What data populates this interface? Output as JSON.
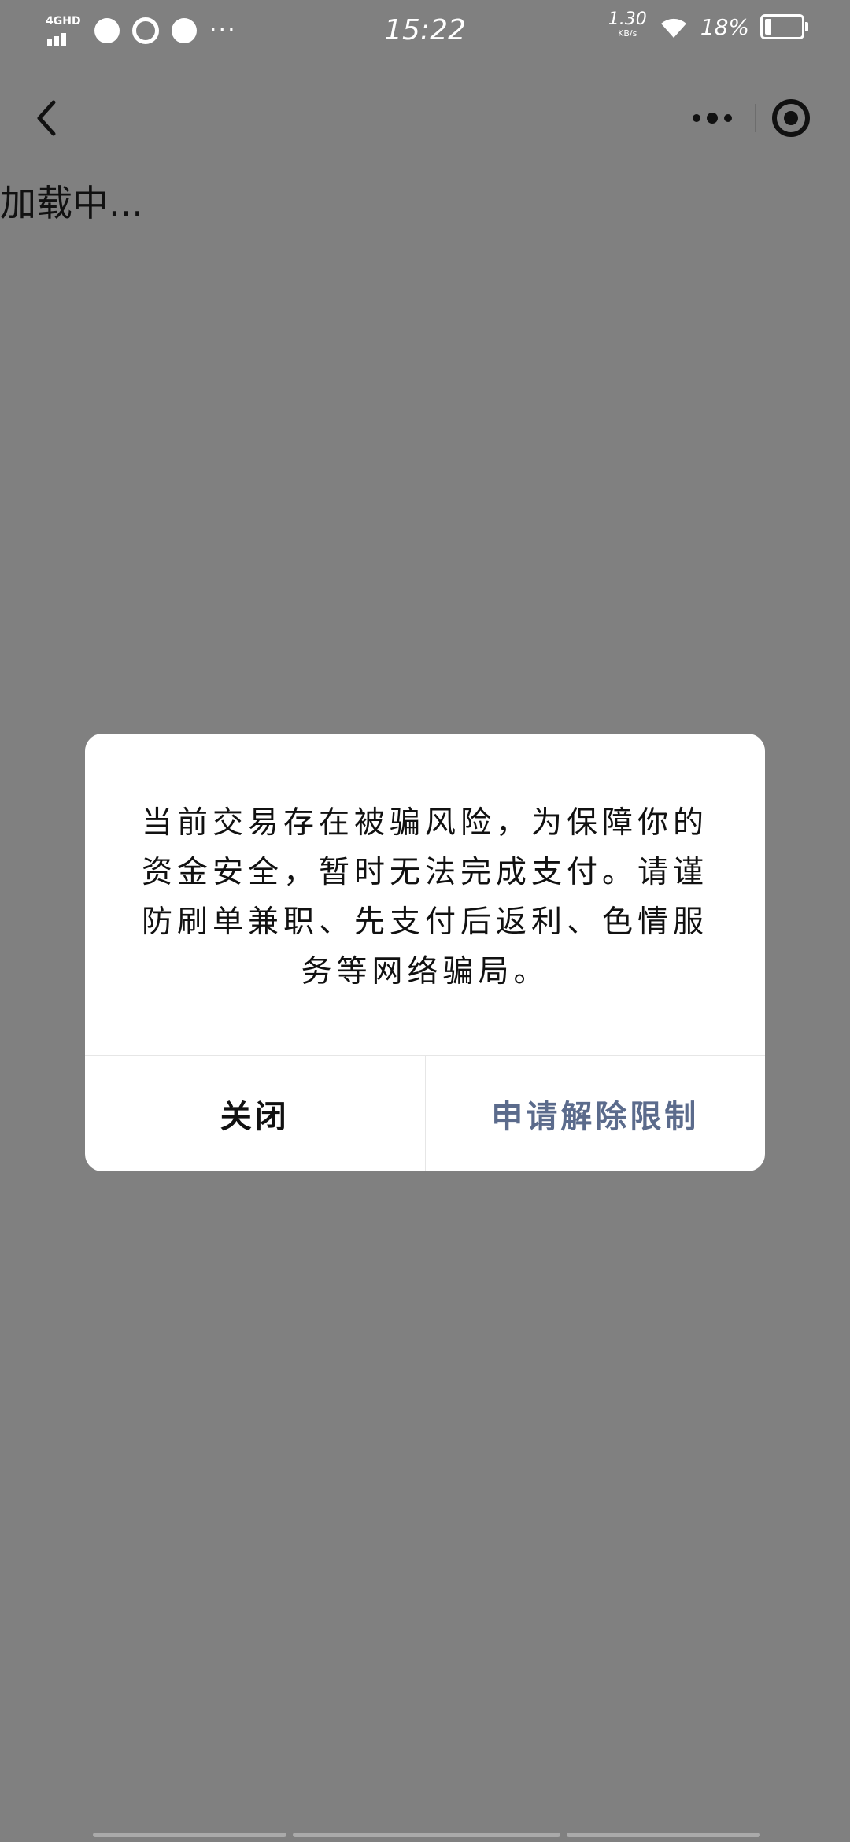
{
  "status_bar": {
    "network": "4GHD",
    "time": "15:22",
    "speed_value": "1.30",
    "speed_unit": "KB/s",
    "battery": "18%"
  },
  "page": {
    "loading_text": "加载中..."
  },
  "dialog": {
    "message": "当前交易存在被骗风险，为保障你的资金安全，暂时无法完成支付。请谨防刷单兼职、先支付后返利、色情服务等网络骗局。",
    "close_label": "关闭",
    "appeal_label": "申请解除限制",
    "appeal_color": "#5b6b8c"
  },
  "colors": {
    "overlay": "#808080",
    "dialog_bg": "#ffffff"
  }
}
